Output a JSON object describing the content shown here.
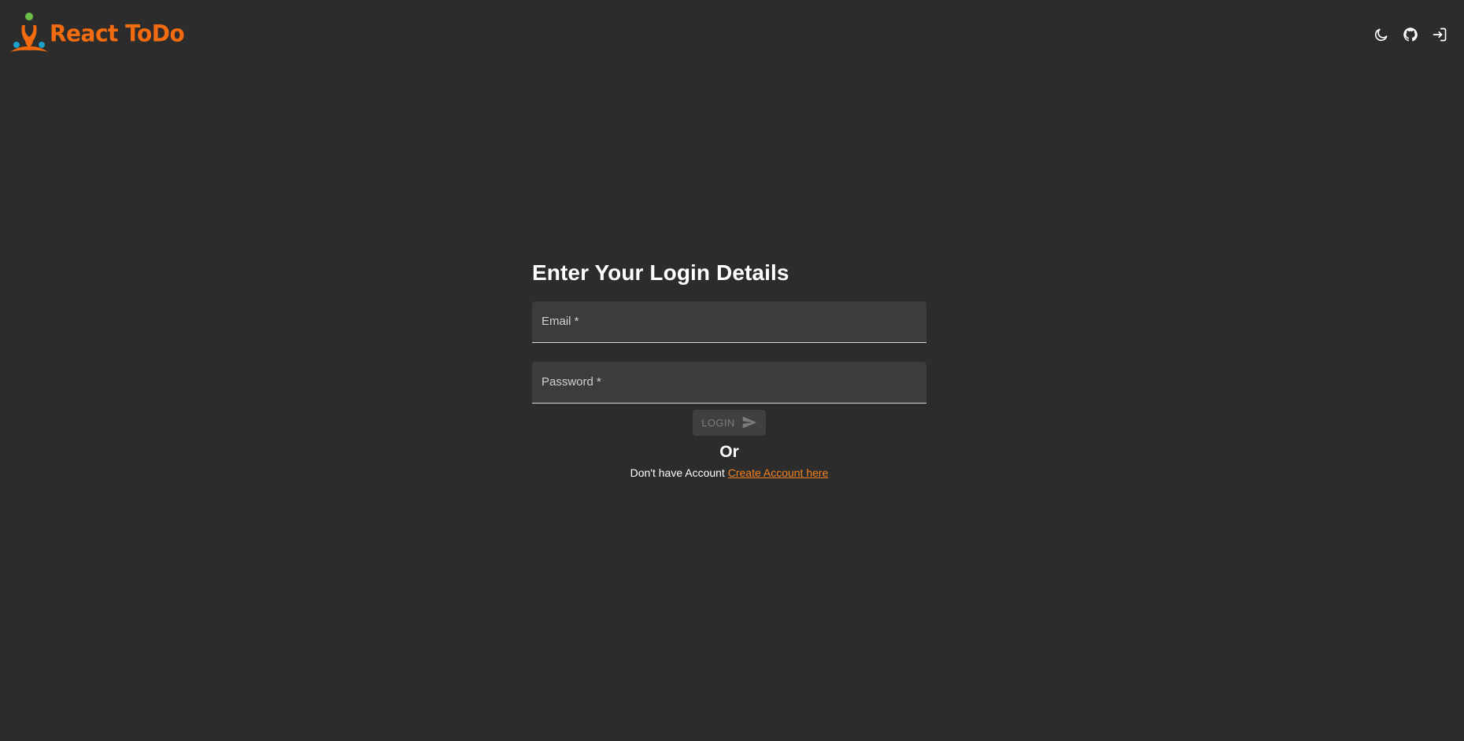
{
  "header": {
    "logo_text": "React ToDo",
    "icons": [
      "dark-mode-moon-icon",
      "github-icon",
      "login-icon"
    ]
  },
  "login_form": {
    "title": "Enter Your Login Details",
    "email_label": "Email *",
    "password_label": "Password *",
    "login_button_label": "LOGIN",
    "or_text": "Or",
    "signup_prompt": "Don't have Account",
    "signup_link": "Create Account here"
  },
  "colors": {
    "background": "#2c2c2c",
    "brand_orange": "#f26b0f",
    "link_orange": "#f5841f",
    "input_fill": "#3c3c3c",
    "disabled_button": "#404040"
  }
}
